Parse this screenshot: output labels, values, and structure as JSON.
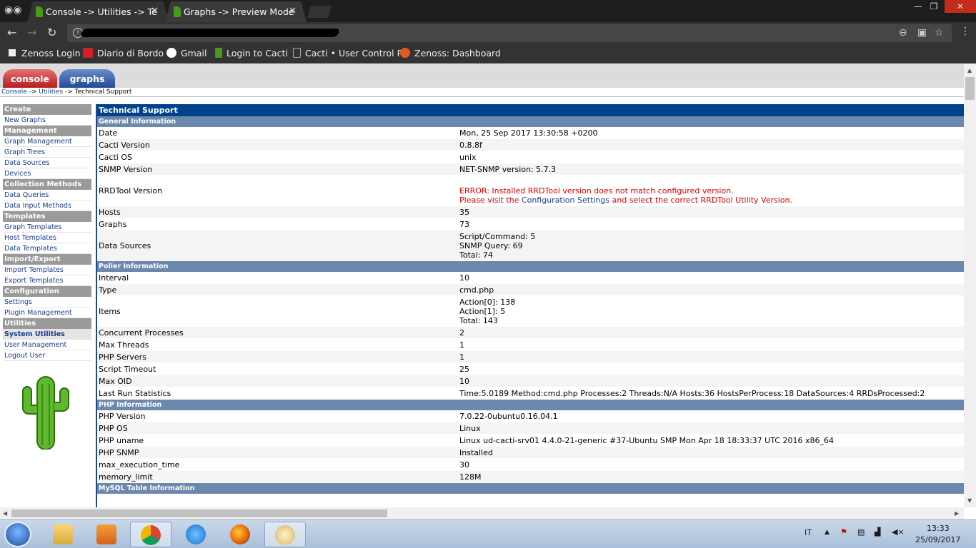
{
  "browser": {
    "tabs": [
      {
        "title": "Console -> Utilities -> Te",
        "active": true
      },
      {
        "title": "Graphs -> Preview Mode",
        "active": false
      }
    ],
    "address_redacted": true,
    "bookmarks": [
      {
        "label": "Zenoss Login",
        "icon": "zenoss-icon"
      },
      {
        "label": "Diario di Bordo",
        "icon": "is-icon"
      },
      {
        "label": "Gmail",
        "icon": "google-icon"
      },
      {
        "label": "Login to Cacti",
        "icon": "cacti-icon"
      },
      {
        "label": "Cacti • User Control P",
        "icon": "page-icon"
      },
      {
        "label": "Zenoss: Dashboard",
        "icon": "zenoss-dashboard-icon"
      }
    ]
  },
  "cacti": {
    "top_tabs": {
      "console": "console",
      "graphs": "graphs"
    },
    "breadcrumb": {
      "console": "Console",
      "sep1": " -> ",
      "utilities": "Utilities",
      "sep2": " -> ",
      "current": "Technical Support"
    },
    "sidebar": [
      {
        "type": "head",
        "label": "Create"
      },
      {
        "type": "item",
        "label": "New Graphs"
      },
      {
        "type": "head",
        "label": "Management"
      },
      {
        "type": "item",
        "label": "Graph Management"
      },
      {
        "type": "item",
        "label": "Graph Trees"
      },
      {
        "type": "item",
        "label": "Data Sources"
      },
      {
        "type": "item",
        "label": "Devices"
      },
      {
        "type": "head",
        "label": "Collection Methods"
      },
      {
        "type": "item",
        "label": "Data Queries"
      },
      {
        "type": "item",
        "label": "Data Input Methods"
      },
      {
        "type": "head",
        "label": "Templates"
      },
      {
        "type": "item",
        "label": "Graph Templates"
      },
      {
        "type": "item",
        "label": "Host Templates"
      },
      {
        "type": "item",
        "label": "Data Templates"
      },
      {
        "type": "head",
        "label": "Import/Export"
      },
      {
        "type": "item",
        "label": "Import Templates"
      },
      {
        "type": "item",
        "label": "Export Templates"
      },
      {
        "type": "head",
        "label": "Configuration"
      },
      {
        "type": "item",
        "label": "Settings"
      },
      {
        "type": "item",
        "label": "Plugin Management"
      },
      {
        "type": "head",
        "label": "Utilities"
      },
      {
        "type": "item",
        "label": "System Utilities",
        "selected": true
      },
      {
        "type": "item",
        "label": "User Management"
      },
      {
        "type": "item",
        "label": "Logout User"
      }
    ],
    "title": "Technical Support",
    "sections": [
      {
        "name": "General Information",
        "rows": [
          {
            "k": "Date",
            "v": [
              "Mon, 25 Sep 2017 13:30:58 +0200"
            ]
          },
          {
            "k": "Cacti Version",
            "v": [
              "0.8.8f"
            ]
          },
          {
            "k": "Cacti OS",
            "v": [
              "unix"
            ]
          },
          {
            "k": "SNMP Version",
            "v": [
              "NET-SNMP version: 5.7.3"
            ]
          },
          {
            "k": "RRDTool Version",
            "error": true,
            "v": [
              "",
              "ERROR: Installed RRDTool version does not match configured version."
            ],
            "v_pre": "Please visit the ",
            "v_link": "Configuration Settings",
            "v_post": " and select the correct RRDTool Utility Version."
          },
          {
            "k": "Hosts",
            "v": [
              "35"
            ]
          },
          {
            "k": "Graphs",
            "v": [
              "73"
            ]
          },
          {
            "k": "Data Sources",
            "v": [
              "Script/Command: 5",
              "SNMP Query: 69",
              "Total: 74"
            ]
          }
        ]
      },
      {
        "name": "Poller Information",
        "rows": [
          {
            "k": "Interval",
            "v": [
              "10"
            ]
          },
          {
            "k": "Type",
            "v": [
              "cmd.php"
            ]
          },
          {
            "k": "Items",
            "v": [
              "Action[0]: 138",
              "Action[1]: 5",
              "Total: 143"
            ]
          },
          {
            "k": "Concurrent Processes",
            "v": [
              "2"
            ]
          },
          {
            "k": "Max Threads",
            "v": [
              "1"
            ]
          },
          {
            "k": "PHP Servers",
            "v": [
              "1"
            ]
          },
          {
            "k": "Script Timeout",
            "v": [
              "25"
            ]
          },
          {
            "k": "Max OID",
            "v": [
              "10"
            ]
          },
          {
            "k": "Last Run Statistics",
            "v": [
              "Time:5.0189 Method:cmd.php Processes:2 Threads:N/A Hosts:36 HostsPerProcess:18 DataSources:4 RRDsProcessed:2"
            ]
          }
        ]
      },
      {
        "name": "PHP Information",
        "rows": [
          {
            "k": "PHP Version",
            "v": [
              "7.0.22-0ubuntu0.16.04.1"
            ]
          },
          {
            "k": "PHP OS",
            "v": [
              "Linux"
            ]
          },
          {
            "k": "PHP uname",
            "v": [
              "Linux ud-cacti-srv01 4.4.0-21-generic #37-Ubuntu SMP Mon Apr 18 18:33:37 UTC 2016 x86_64"
            ]
          },
          {
            "k": "PHP SNMP",
            "v": [
              "Installed"
            ]
          },
          {
            "k": "max_execution_time",
            "v": [
              "30"
            ]
          },
          {
            "k": "memory_limit",
            "v": [
              "128M"
            ]
          }
        ]
      },
      {
        "name": "MySQL Table Information",
        "rows": []
      }
    ]
  },
  "taskbar": {
    "lang": "IT",
    "time": "13:33",
    "date": "25/09/2017",
    "apps": [
      "explorer-icon",
      "media-player-icon",
      "chrome-icon",
      "internet-explorer-icon",
      "firefox-icon",
      "paint-icon"
    ]
  },
  "colors": {
    "cacti_blue": "#00438c",
    "section_blue": "#6d88ad",
    "error_red": "#e00000",
    "link_blue": "#1a3c8e"
  }
}
